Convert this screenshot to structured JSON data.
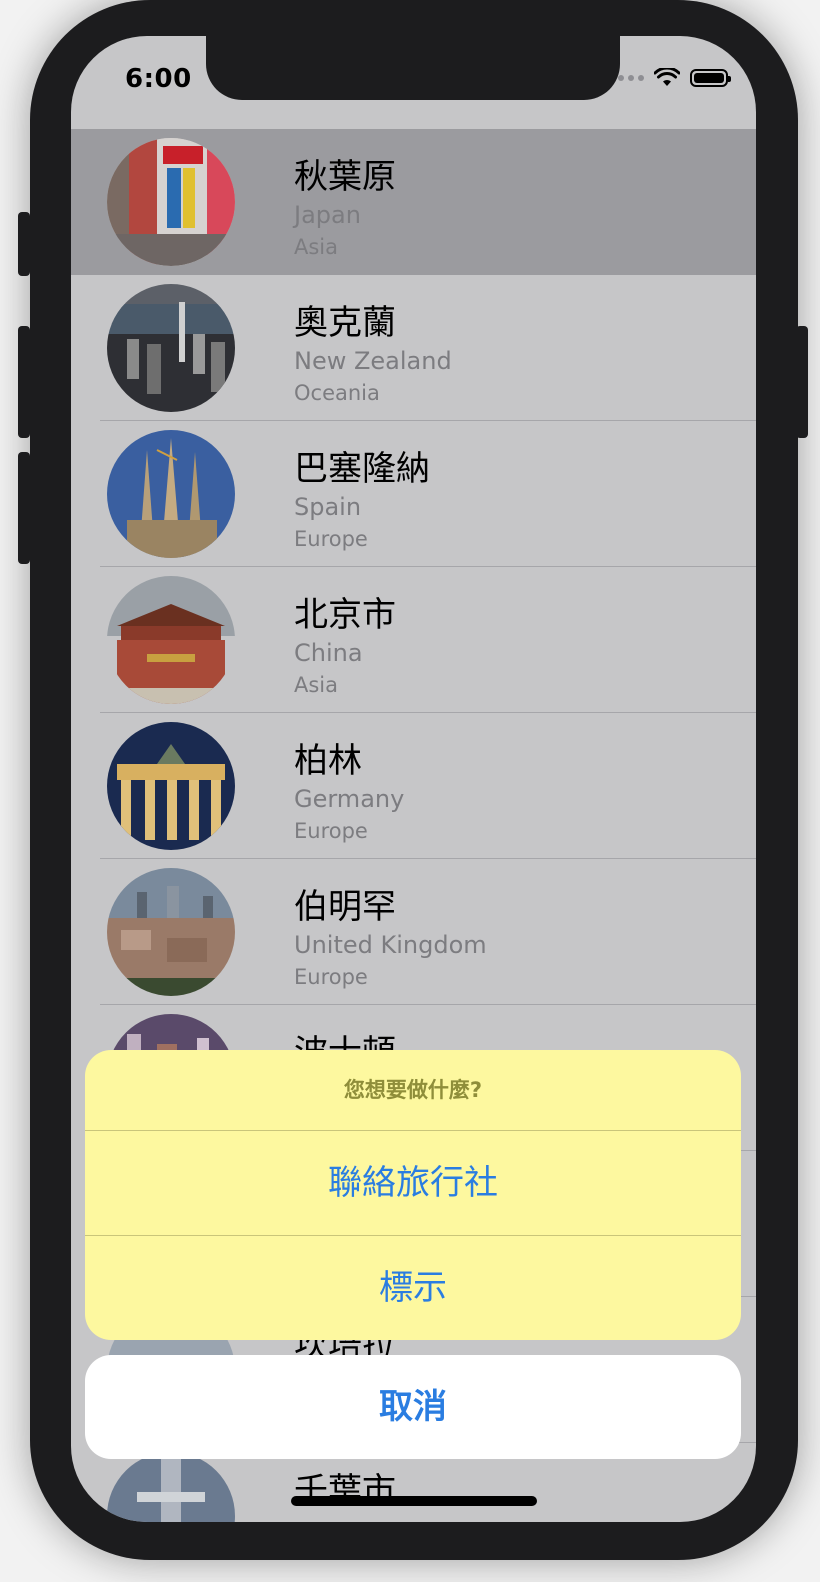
{
  "status_bar": {
    "time": "6:00"
  },
  "restaurants": [
    {
      "name": "秋葉原",
      "country": "Japan",
      "region": "Asia",
      "selected": true
    },
    {
      "name": "奧克蘭",
      "country": "New Zealand",
      "region": "Oceania"
    },
    {
      "name": "巴塞隆納",
      "country": "Spain",
      "region": "Europe"
    },
    {
      "name": "北京市",
      "country": "China",
      "region": "Asia"
    },
    {
      "name": "柏林",
      "country": "Germany",
      "region": "Europe"
    },
    {
      "name": "伯明罕",
      "country": "United Kingdom",
      "region": "Europe"
    },
    {
      "name": "波士頓",
      "country": "",
      "region": ""
    },
    {
      "name": "",
      "country": "",
      "region": ""
    },
    {
      "name": "坎培拉",
      "country": "",
      "region": ""
    },
    {
      "name": "千葉市",
      "country": "",
      "region": ""
    }
  ],
  "action_sheet": {
    "title": "您想要做什麼?",
    "actions": [
      "聯絡旅行社",
      "標示"
    ],
    "cancel": "取消"
  },
  "colors": {
    "sheet_background": "#fdf89f",
    "action_text": "#2a7de1",
    "dimmed_background": "#c6c6c8",
    "selected_row": "#9b9b9f"
  }
}
